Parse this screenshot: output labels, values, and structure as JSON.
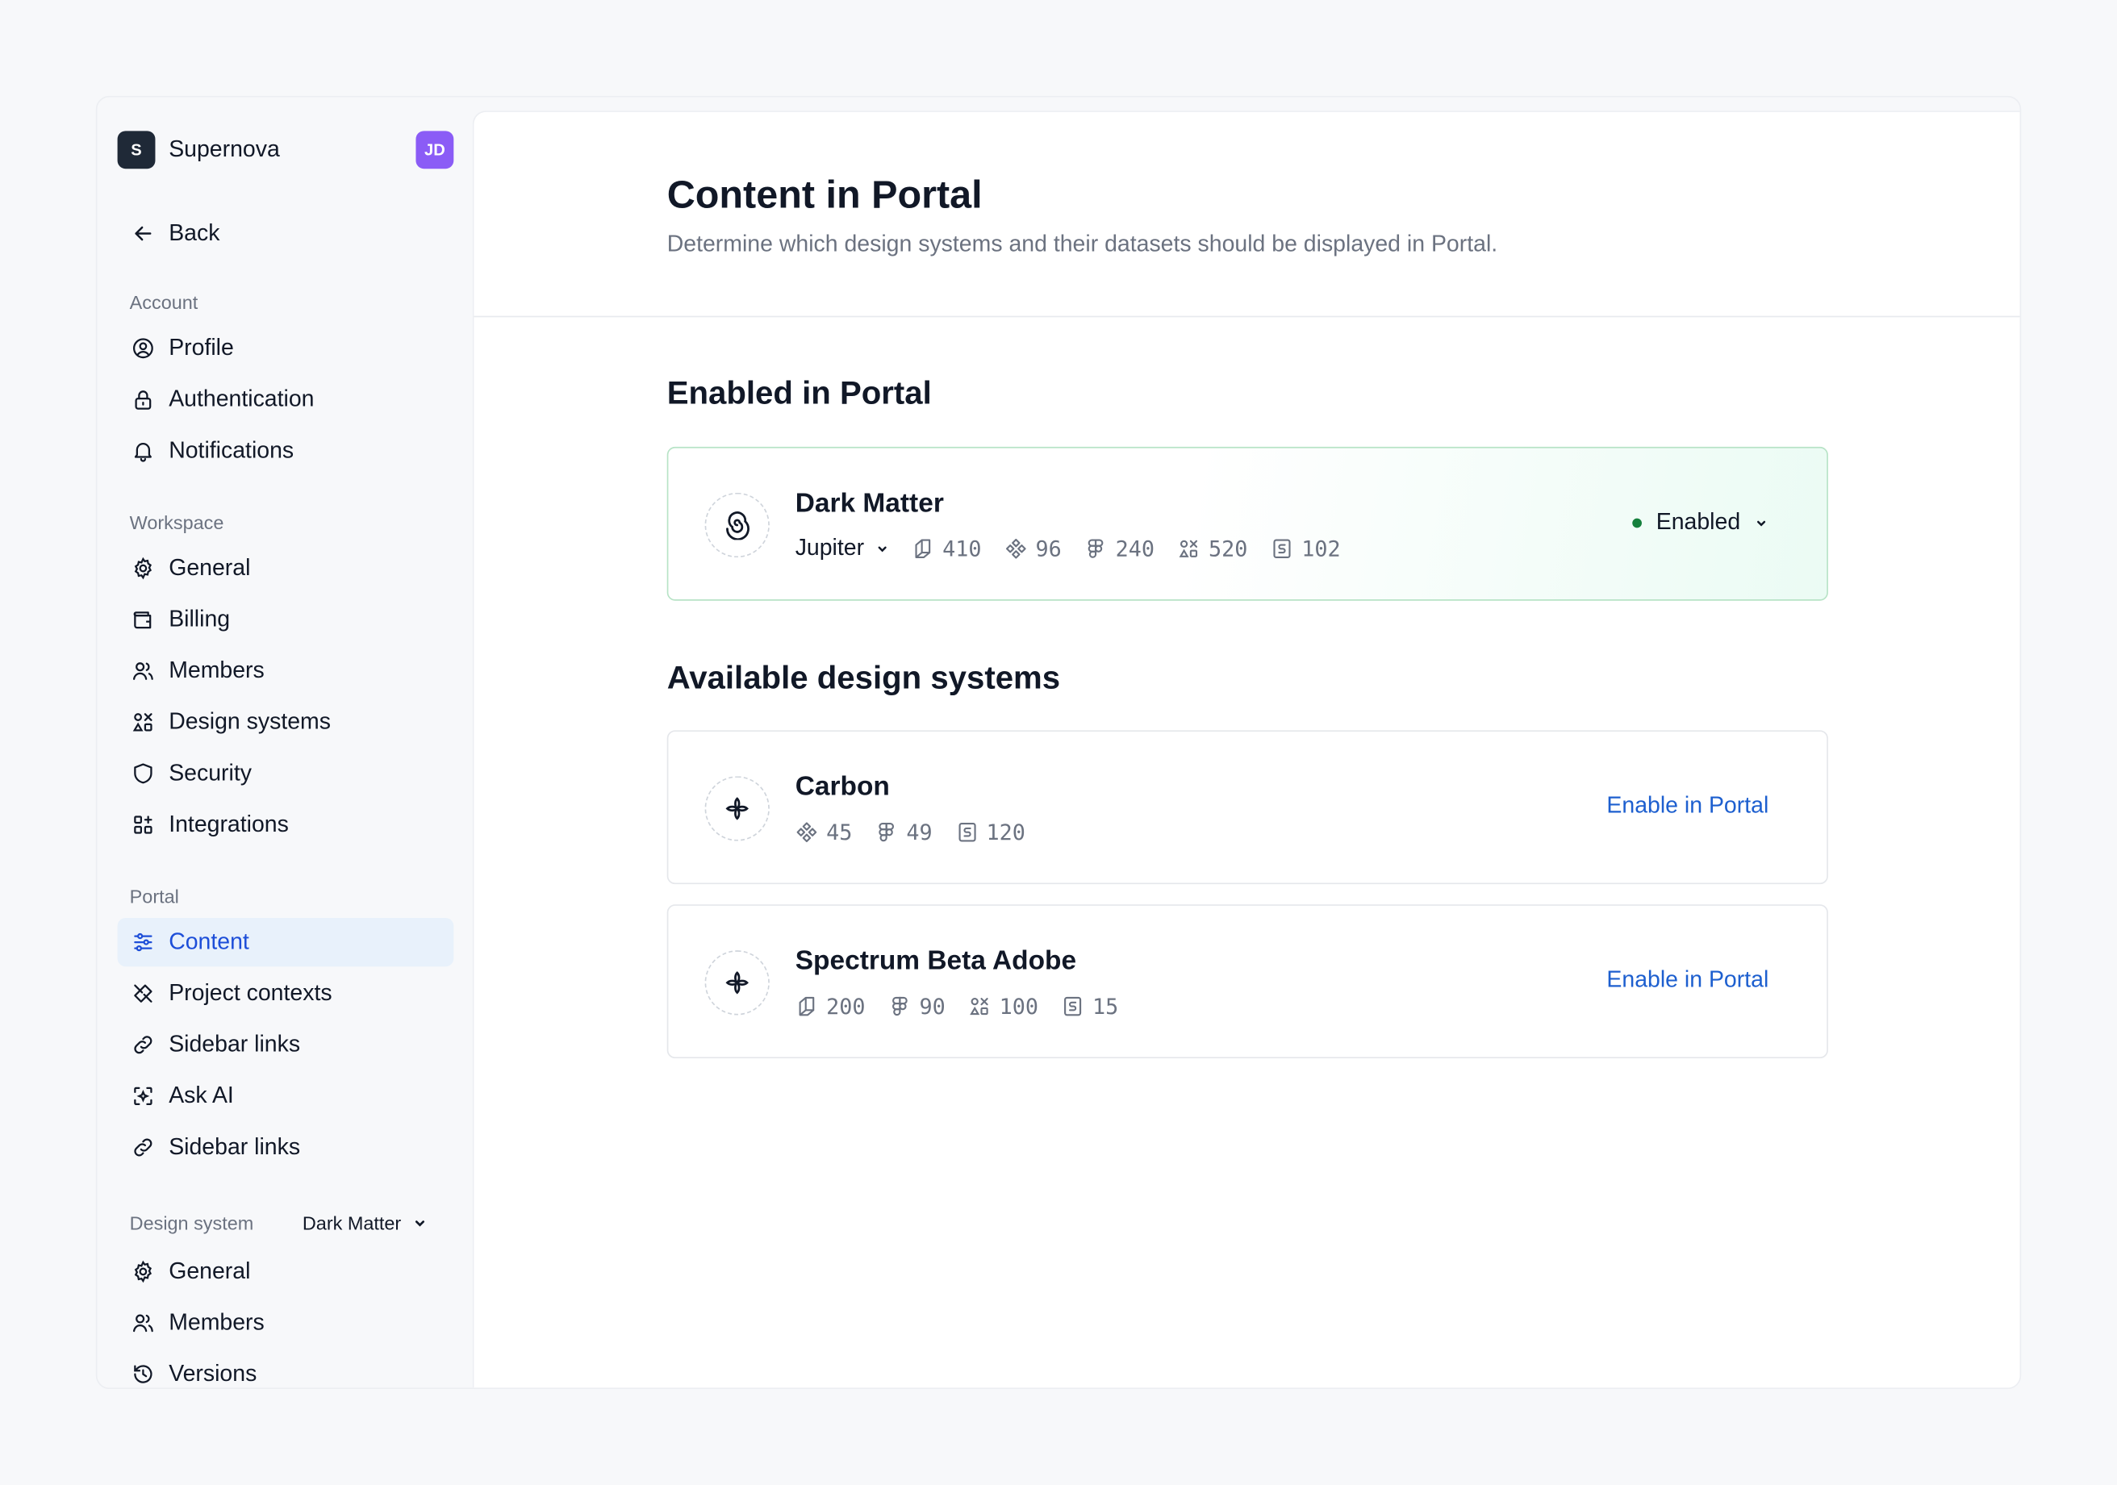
{
  "workspace": {
    "logo_letter": "S",
    "name": "Supernova",
    "avatar_initials": "JD"
  },
  "sidebar": {
    "back_label": "Back",
    "account": {
      "label": "Account",
      "items": [
        "Profile",
        "Authentication",
        "Notifications"
      ]
    },
    "workspace": {
      "label": "Workspace",
      "items": [
        "General",
        "Billing",
        "Members",
        "Design systems",
        "Security",
        "Integrations"
      ]
    },
    "portal": {
      "label": "Portal",
      "items": [
        "Content",
        "Project contexts",
        "Sidebar links",
        "Ask AI",
        "Sidebar links"
      ],
      "active": "Content"
    },
    "design_system": {
      "label": "Design system",
      "selected": "Dark Matter",
      "items": [
        "General",
        "Members",
        "Versions"
      ]
    }
  },
  "main": {
    "title": "Content in Portal",
    "subtitle": "Determine which design systems and their datasets should be displayed in Portal.",
    "enabled_section_title": "Enabled in Portal",
    "available_section_title": "Available design systems",
    "enabled": [
      {
        "name": "Dark Matter",
        "version": "Jupiter",
        "stats": {
          "documentation": "410",
          "components": "96",
          "figma": "240",
          "assets": "520",
          "tokens": "102"
        },
        "status": "Enabled"
      }
    ],
    "available": [
      {
        "name": "Carbon",
        "stats": {
          "components": "45",
          "figma": "49",
          "tokens": "120"
        },
        "action": "Enable in Portal"
      },
      {
        "name": "Spectrum Beta Adobe",
        "stats": {
          "documentation": "200",
          "figma": "90",
          "assets": "100",
          "tokens": "15"
        },
        "action": "Enable in Portal"
      }
    ]
  },
  "colors": {
    "accent": "#1d5fcf",
    "active_bg": "#e8f1fb",
    "enabled_dot": "#15803d",
    "avatar": "#8b5cf6"
  }
}
